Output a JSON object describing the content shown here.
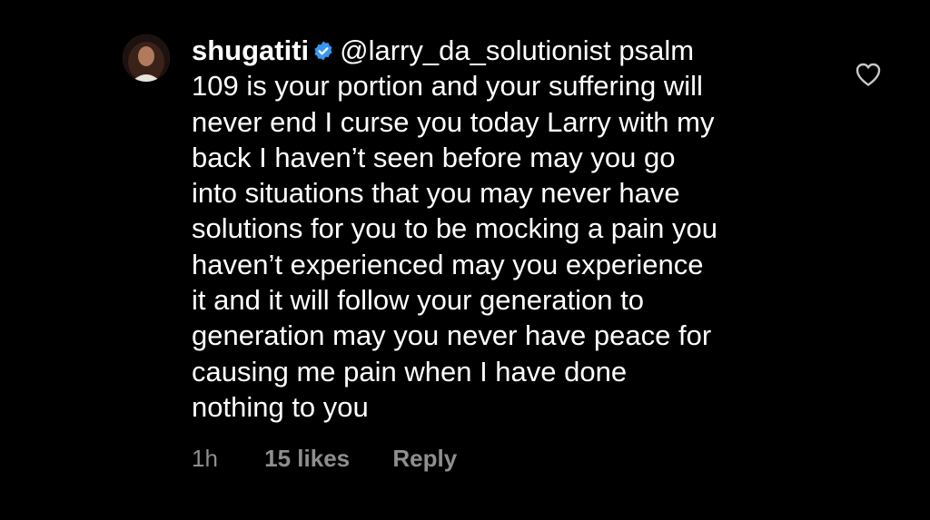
{
  "comment": {
    "username": "shugatiti",
    "verified_icon": "verified-badge-icon",
    "lines": [
      "@larry_da_solutionist psalm",
      "109 is your portion and your suffering will",
      "never end I curse you today Larry with my",
      "back I haven’t seen before may you go",
      "into situations that you may never have",
      "solutions for you to be mocking a pain you",
      "haven’t experienced may you experience",
      "it and it will follow your generation to",
      "generation may you never have peace for",
      "causing me pain when I have done",
      "nothing to you"
    ],
    "time": "1h",
    "likes": "15 likes",
    "reply_label": "Reply",
    "like_icon": "heart-outline-icon"
  },
  "colors": {
    "background": "#000000",
    "text": "#ffffff",
    "meta": "#8e8e8e",
    "verified": "#3897f0"
  }
}
